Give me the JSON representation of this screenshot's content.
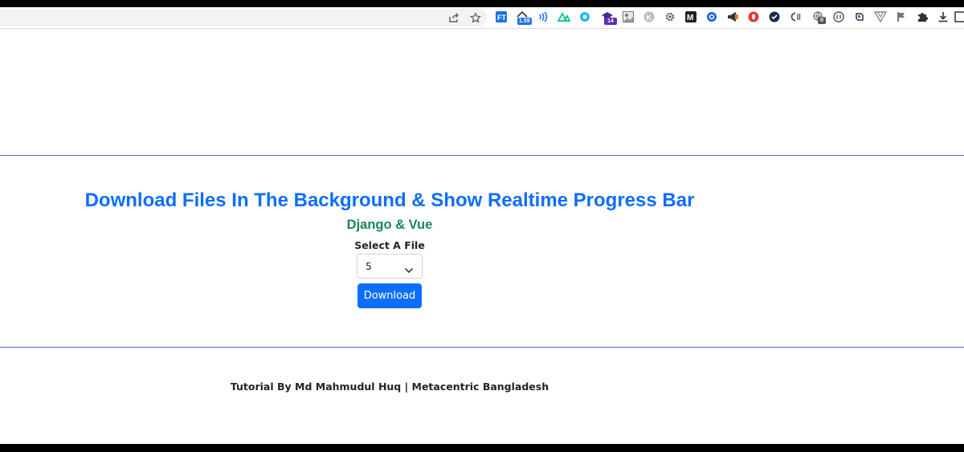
{
  "browser": {
    "extensions": [
      {
        "icon": "share-icon"
      },
      {
        "icon": "star-icon"
      },
      {
        "icon": "extension-ft-icon",
        "label": "FT"
      },
      {
        "icon": "extension-home-icon",
        "badge": "1.59"
      },
      {
        "icon": "extension-wave-icon"
      },
      {
        "icon": "extension-nuxt-icon"
      },
      {
        "icon": "extension-bubble-icon"
      },
      {
        "icon": "extension-cap-icon",
        "badge": "14"
      },
      {
        "icon": "extension-image-icon"
      },
      {
        "icon": "extension-k-icon",
        "label": "K"
      },
      {
        "icon": "extension-gear-icon"
      },
      {
        "icon": "extension-m-icon",
        "label": "M"
      },
      {
        "icon": "extension-blue-circle-icon"
      },
      {
        "icon": "extension-megaphone-icon"
      },
      {
        "icon": "extension-red-shield-icon"
      },
      {
        "icon": "extension-check-icon"
      },
      {
        "icon": "extension-ci-icon"
      },
      {
        "icon": "extension-globe-icon",
        "badge": "II"
      },
      {
        "icon": "extension-circle-i-icon"
      },
      {
        "icon": "extension-bell-icon"
      },
      {
        "icon": "extension-vue-icon"
      },
      {
        "icon": "extension-flag-icon"
      },
      {
        "icon": "puzzle-icon"
      },
      {
        "icon": "download-icon"
      },
      {
        "icon": "side-panel-icon"
      }
    ]
  },
  "page": {
    "title": "Download Files In The Background & Show Realtime Progress Bar",
    "subtitle": "Django & Vue",
    "select_label": "Select A File",
    "select_value": "5",
    "download_label": "Download",
    "footer": "Tutorial By Md Mahmudul Huq | Metacentric Bangladesh"
  },
  "colors": {
    "title": "#0d6efd",
    "subtitle": "#198754",
    "button": "#0d6efd",
    "divider": "#4a6cb3"
  }
}
